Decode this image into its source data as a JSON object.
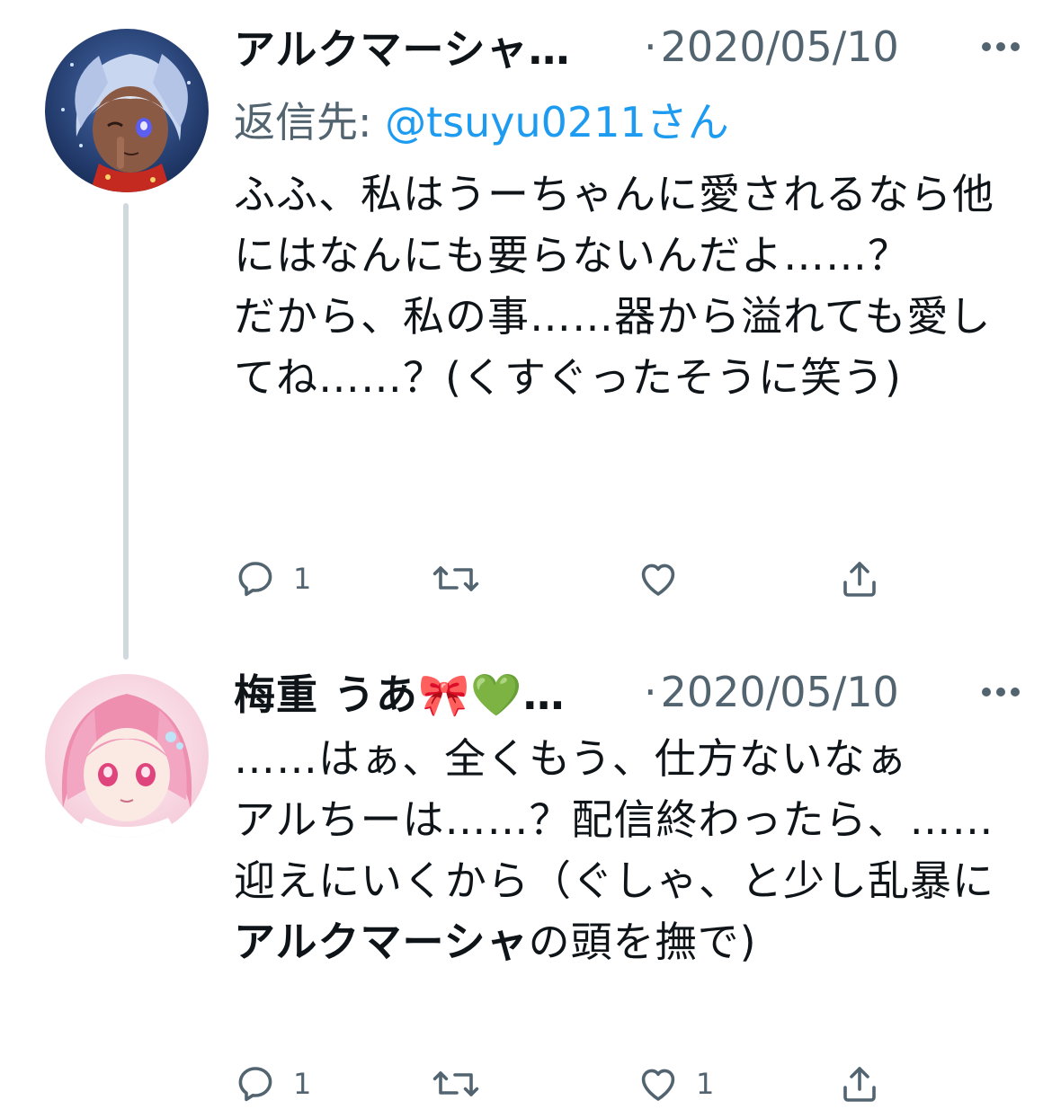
{
  "thread": {
    "tweets": [
      {
        "display_name": "アルクマーシャ…",
        "separator": "·",
        "date": "2020/05/10",
        "reply_to_label": "返信先: ",
        "reply_to_handle": "@tsuyu0211さん",
        "text": "ふふ、私はうーちゃんに愛されるなら他にはなんにも要らないんだよ……？\nだから、私の事……器から溢れても愛してね……？(くすぐったそうに笑う)",
        "reply_count": "1",
        "retweet_count": "",
        "like_count": "",
        "avatar_icon": "avatar-blue-haired-character"
      },
      {
        "display_name": "梅重 うあ🎀💚…",
        "separator": "·",
        "date": "2020/05/10",
        "text_part1": "……はぁ、全くもう、仕方ないなぁ\nアルちーは……？配信終わったら、……迎えにいくから（ぐしゃ、と少し乱暴に",
        "text_bold": "アルクマーシャ",
        "text_part2": "の頭を撫で)",
        "reply_count": "1",
        "retweet_count": "",
        "like_count": "1",
        "avatar_icon": "avatar-pink-haired-character"
      }
    ]
  },
  "colors": {
    "text": "#0f1419",
    "secondary": "#536471",
    "link": "#1d9bf0",
    "thread_line": "#cfd9de"
  }
}
